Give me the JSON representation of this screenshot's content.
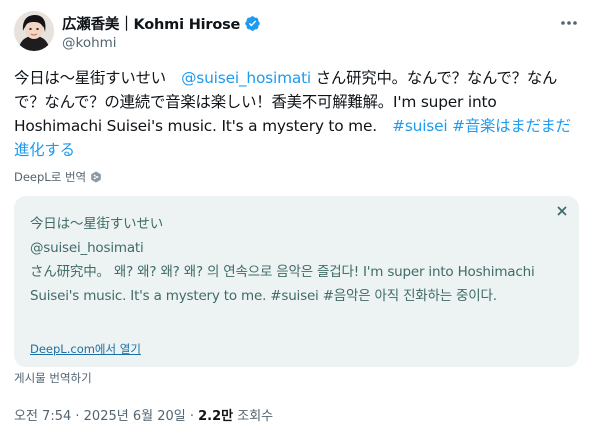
{
  "author": {
    "display_name": "広瀬香美｜Kohmi Hirose",
    "handle": "@kohmi"
  },
  "tweet": {
    "prefix": "今日は〜星街すいせい　",
    "mention": "@suisei_hosimati",
    "body": " さん研究中。なんで？なんで？なんで？なんで？の連続で音楽は楽しい！香美不可解難解。I'm super into Hoshimachi Suisei's music. It's a mystery to me.　",
    "hashtag1": "#suisei",
    "hashtag2": "#音楽はまだまだ進化する"
  },
  "translate_label": "DeepL로 번역",
  "translation": {
    "text_line1": "今日は〜星街すいせい",
    "text_line2": "@suisei_hosimati",
    "text_rest": "さん研究中。  왜? 왜? 왜? 왜? 의 연속으로 음악은 즐겁다! I'm super into Hoshimachi Suisei's music. It's a mystery to me. #suisei #음악은 아직 진화하는 중이다.",
    "open_link": "DeepL.com에서 열기"
  },
  "show_translation_label": "게시물 번역하기",
  "meta": {
    "time": "오전 7:54",
    "sep1": " · ",
    "date": "2025년 6월 20일",
    "sep2": " · ",
    "views_count": "2.2만",
    "views_label": " 조회수"
  },
  "colors": {
    "link": "#1d9bf0",
    "verified": "#1d9bf0",
    "translation_bg": "#edf3f2"
  },
  "icons": {
    "verified": "verified-badge-icon",
    "more": "more-icon",
    "close": "close-icon",
    "deepl": "deepl-icon"
  }
}
